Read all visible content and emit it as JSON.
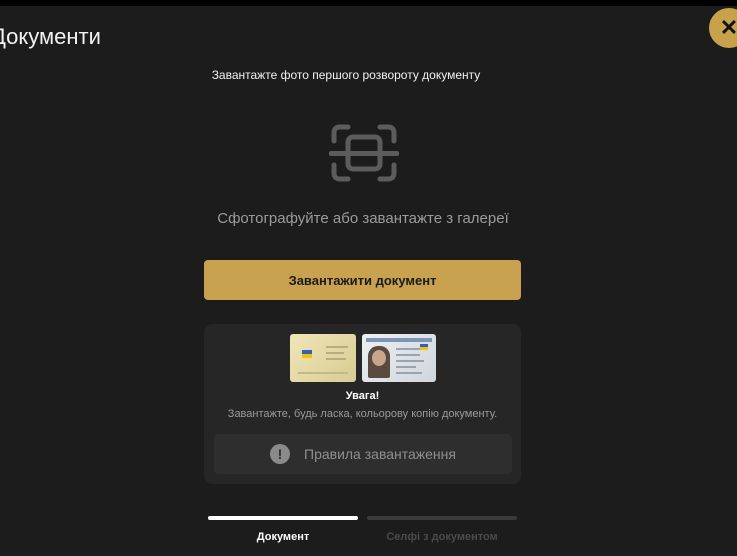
{
  "header": {
    "title": "Документи",
    "close_icon": "close-icon"
  },
  "instruction": "Завантажте фото першого розвороту документу",
  "scan_icon": "document-scan-icon",
  "hint": "Сфотографуйте або завантажте з галереї",
  "upload_button": "Завантажити документ",
  "notice": {
    "title": "Увага!",
    "text": "Завантажте, будь ласка, кольорову копію документу.",
    "rules_button": "Правила завантаження",
    "rules_icon": "exclamation-icon"
  },
  "steps": [
    {
      "label": "Документ",
      "active": true
    },
    {
      "label": "Селфі з документом",
      "active": false
    }
  ],
  "colors": {
    "accent": "#c9a250",
    "background": "#1c1c1c",
    "card": "#262626"
  }
}
